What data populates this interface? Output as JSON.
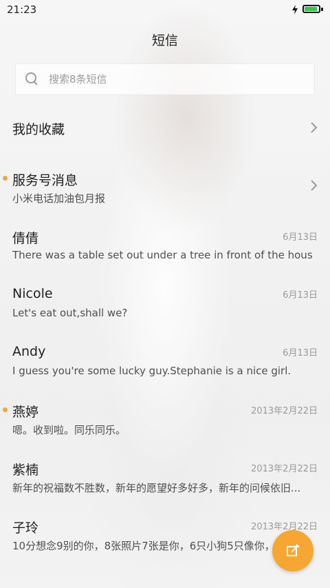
{
  "status": {
    "time": "21:23",
    "battery_percent": 90,
    "colors": {
      "battery_fill": "#2fc84a"
    }
  },
  "header": {
    "title": "短信"
  },
  "search": {
    "placeholder": "搜索8条短信"
  },
  "conversations": [
    {
      "name": "我的收藏",
      "preview": "",
      "time": "",
      "unread": false,
      "arrow": true
    },
    {
      "name": "服务号消息",
      "preview": "小米电话加油包月报",
      "time": "",
      "unread": true,
      "arrow": true
    },
    {
      "name": "倩倩",
      "preview": "There was a table set out under a tree in front of the hous",
      "time": "6月13日",
      "unread": false,
      "arrow": false
    },
    {
      "name": "Nicole",
      "preview": "Let's eat out,shall we?",
      "time": "6月13日",
      "unread": false,
      "arrow": false
    },
    {
      "name": "Andy",
      "preview": "I guess you're some lucky guy.Stephanie is a nice girl.",
      "time": "6月13日",
      "unread": false,
      "arrow": false
    },
    {
      "name": "燕婷",
      "preview": "嗯。收到啦。同乐同乐。",
      "time": "2013年2月22日",
      "unread": true,
      "arrow": false
    },
    {
      "name": "紫楠",
      "preview": "新年的祝福数不胜数，新年的愿望好多好多，新年的问候依旧...",
      "time": "2013年2月22日",
      "unread": false,
      "arrow": false
    },
    {
      "name": "子玲",
      "preview": "10分想念9别的你，8张照片7张是你，6只小狗5只像你，",
      "time": "2013年2月22日",
      "unread": false,
      "arrow": false
    }
  ],
  "fab": {
    "icon": "compose-icon",
    "color": "#f6a732"
  }
}
